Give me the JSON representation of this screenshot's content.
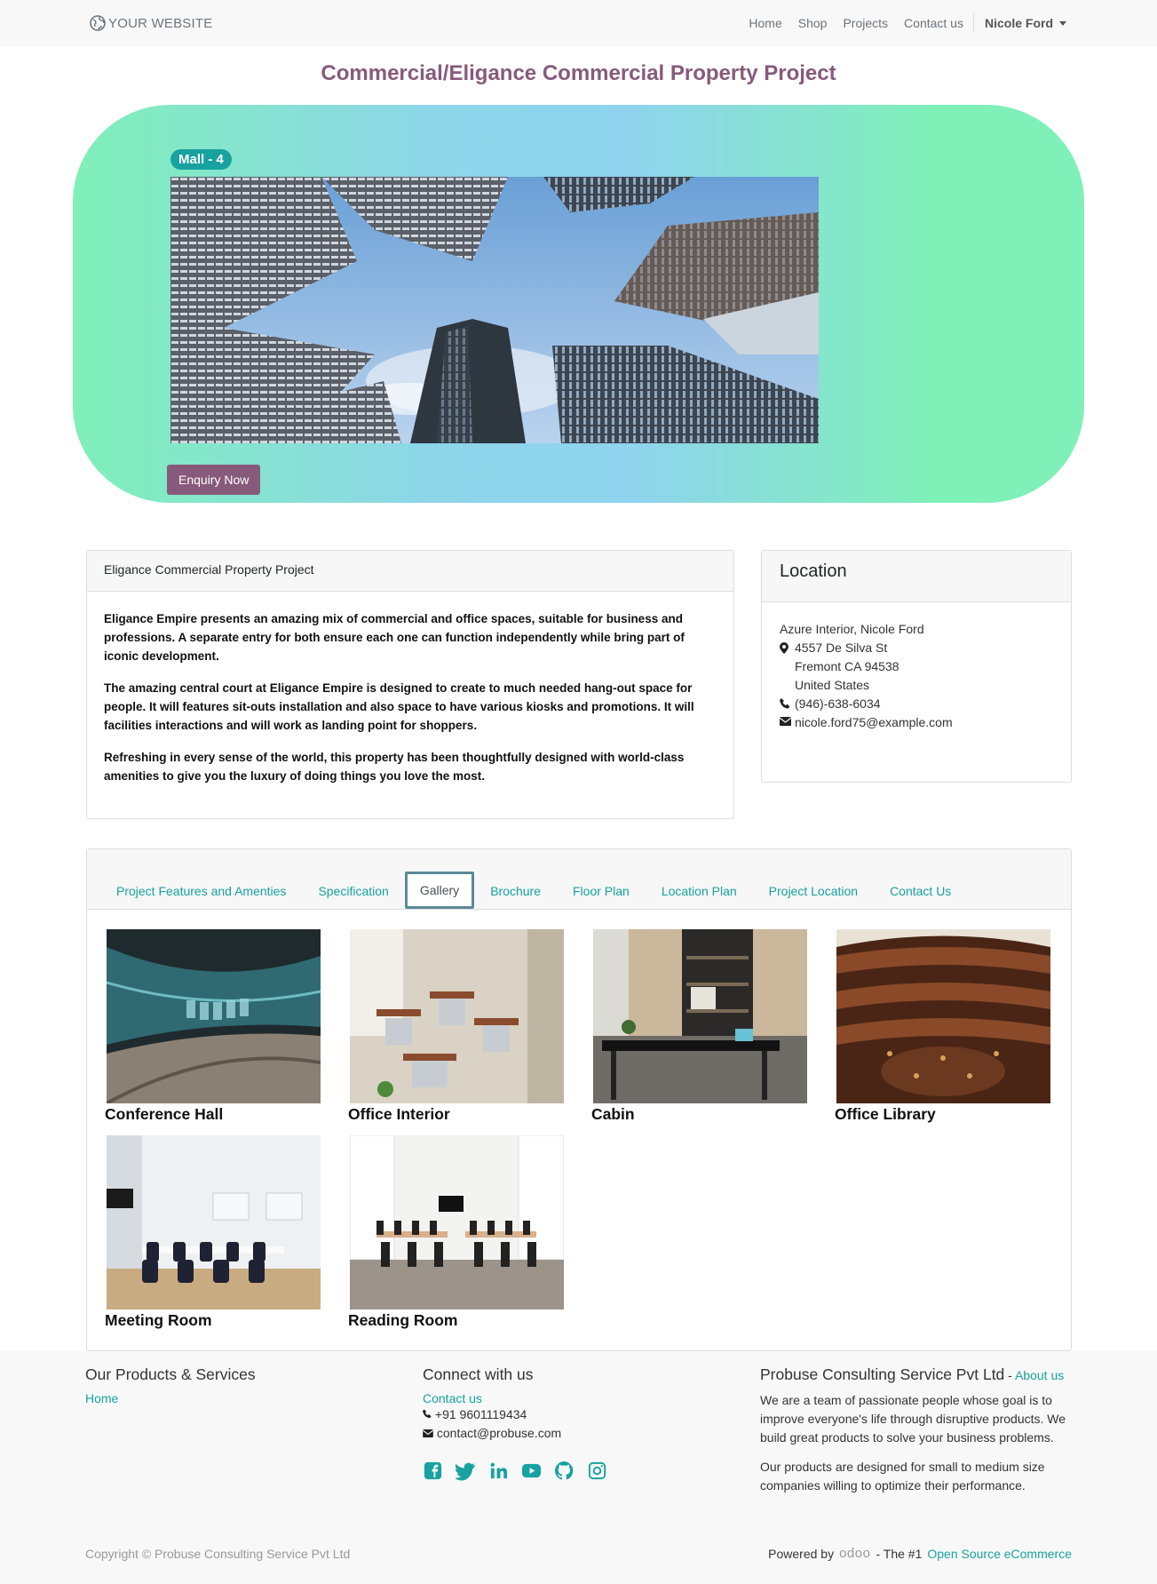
{
  "nav": {
    "brand": "YOUR WEBSITE",
    "links": [
      "Home",
      "Shop",
      "Projects",
      "Contact us"
    ],
    "user": "Nicole Ford"
  },
  "page_title": "Commercial/Eligance Commercial Property Project",
  "hero": {
    "badge": "Mall - 4",
    "enquiry_label": "Enquiry Now"
  },
  "description": {
    "header": "Eligance Commercial Property Project",
    "paragraphs": [
      "Eligance Empire presents an amazing mix of commercial and office spaces, suitable for business and professions. A separate entry for both ensure each one can function independently while bring part of iconic development.",
      "The amazing central court at Eligance Empire is designed to create to much needed hang-out space for people. It will features sit-outs installation and also space to have various kiosks and promotions. It will facilities interactions and will work as landing point for shoppers.",
      "Refreshing in every sense of the world, this property has been thoughtfully designed with world-class amenities to give you the luxury of doing things you love the most."
    ]
  },
  "location": {
    "title": "Location",
    "name": "Azure Interior, Nicole Ford",
    "street": "4557 De Silva St",
    "city": "Fremont CA 94538",
    "country": "United States",
    "phone": "(946)-638-6034",
    "email": "nicole.ford75@example.com"
  },
  "tabs": [
    "Project Features and Amenties",
    "Specification",
    "Gallery",
    "Brochure",
    "Floor Plan",
    "Location Plan",
    "Project Location",
    "Contact Us"
  ],
  "active_tab": "Gallery",
  "gallery": [
    "Conference Hall",
    "Office Interior",
    "Cabin",
    "Office Library",
    "Meeting Room",
    "Reading Room"
  ],
  "footer": {
    "products_title": "Our Products & Services",
    "products_link": "Home",
    "connect_title": "Connect with us",
    "contact_link": "Contact us",
    "phone": "+91 9601119434",
    "email": "contact@probuse.com",
    "company_title": "Probuse Consulting Service Pvt Ltd",
    "company_sep": " - ",
    "about_link": "About us",
    "about_p1": "We are a team of passionate people whose goal is to improve everyone's life through disruptive products. We build great products to solve your business problems.",
    "about_p2": "Our products are designed for small to medium size companies willing to optimize their performance.",
    "copyright": "Copyright © Probuse Consulting Service Pvt Ltd",
    "powered_by": "Powered by",
    "odoo": "odoo",
    "the1": "- The #1",
    "open_source": "Open Source eCommerce"
  },
  "colors": {
    "accent": "#875a7b",
    "teal": "#17a2a0"
  }
}
